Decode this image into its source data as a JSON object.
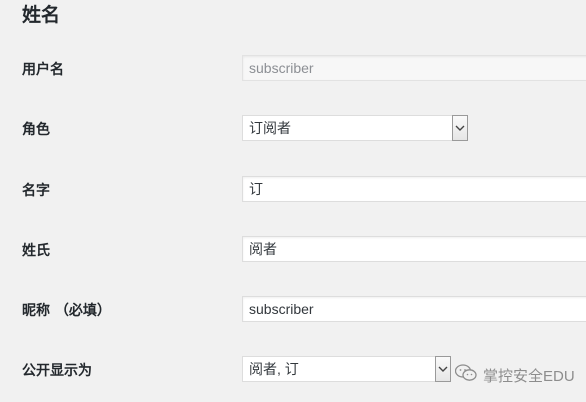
{
  "section": {
    "title": "姓名"
  },
  "fields": {
    "username": {
      "label": "用户名",
      "value": "subscriber"
    },
    "role": {
      "label": "角色",
      "selected": "订阅者"
    },
    "first_name": {
      "label": "名字",
      "value": "订"
    },
    "last_name": {
      "label": "姓氏",
      "value": "阅者"
    },
    "nickname": {
      "label": "昵称 （必填）",
      "value": "subscriber"
    },
    "display_name": {
      "label": "公开显示为",
      "selected": "阅者, 订"
    }
  },
  "watermark": {
    "text": "掌控安全EDU",
    "icon": "wechat-icon"
  },
  "colors": {
    "page_bg": "#f1f1f1",
    "label_text": "#23282d",
    "field_border": "#dddddd",
    "disabled_text": "#8c8f94"
  }
}
